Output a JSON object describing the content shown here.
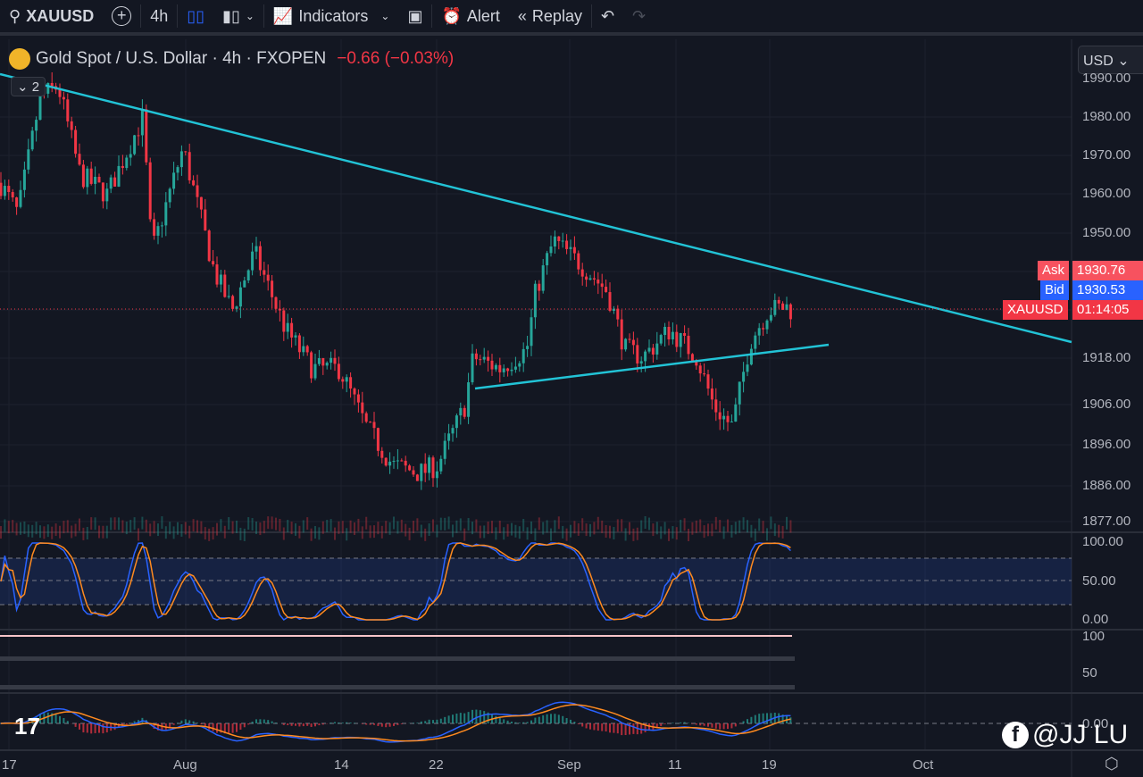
{
  "toolbar": {
    "symbol": "XAUUSD",
    "interval": "4h",
    "indicators": "Indicators",
    "alert": "Alert",
    "replay": "Replay"
  },
  "legend": {
    "title": "Gold Spot / U.S. Dollar · 4h · FXOPEN",
    "change": "−0.66 (−0.03%)",
    "collapsed_count": "2"
  },
  "currency": "USD",
  "price_axis": [
    "1990.00",
    "1980.00",
    "1970.00",
    "1960.00",
    "1950.00",
    "1918.00",
    "1906.00",
    "1896.00",
    "1886.00",
    "1877.00"
  ],
  "tags": {
    "ask_label": "Ask",
    "ask": "1930.76",
    "bid_label": "Bid",
    "bid": "1930.53",
    "symbol_label": "XAUUSD",
    "countdown": "01:14:05"
  },
  "stoch_axis": [
    "100.00",
    "50.00",
    "0.00"
  ],
  "pane2_axis": [
    "100",
    "50"
  ],
  "macd_axis": "0.00",
  "time_axis": [
    "17",
    "Aug",
    "14",
    "22",
    "Sep",
    "11",
    "19",
    "Oct"
  ],
  "watermark": "@JJ LU",
  "colors": {
    "up": "#26a69a",
    "down": "#f23645",
    "trend": "#22c3d6",
    "k": "#2962ff",
    "d": "#ff8a1f"
  },
  "chart_data": {
    "type": "candlestick",
    "symbol": "XAUUSD",
    "interval": "4h",
    "path": [
      [
        0,
        1963
      ],
      [
        20,
        1955
      ],
      [
        45,
        1985
      ],
      [
        65,
        1988
      ],
      [
        90,
        1965
      ],
      [
        120,
        1960
      ],
      [
        160,
        1980
      ],
      [
        170,
        1945
      ],
      [
        205,
        1972
      ],
      [
        240,
        1940
      ],
      [
        260,
        1930
      ],
      [
        285,
        1945
      ],
      [
        320,
        1925
      ],
      [
        350,
        1915
      ],
      [
        380,
        1915
      ],
      [
        410,
        1900
      ],
      [
        440,
        1890
      ],
      [
        470,
        1888
      ],
      [
        490,
        1890
      ],
      [
        520,
        1905
      ],
      [
        530,
        1918
      ],
      [
        560,
        1915
      ],
      [
        590,
        1920
      ],
      [
        600,
        1935
      ],
      [
        620,
        1948
      ],
      [
        650,
        1942
      ],
      [
        680,
        1935
      ],
      [
        700,
        1920
      ],
      [
        720,
        1918
      ],
      [
        750,
        1925
      ],
      [
        780,
        1918
      ],
      [
        800,
        1905
      ],
      [
        820,
        1900
      ],
      [
        840,
        1922
      ],
      [
        860,
        1930
      ],
      [
        880,
        1931
      ],
      [
        887,
        1930
      ]
    ],
    "last_price": 1930.53
  }
}
